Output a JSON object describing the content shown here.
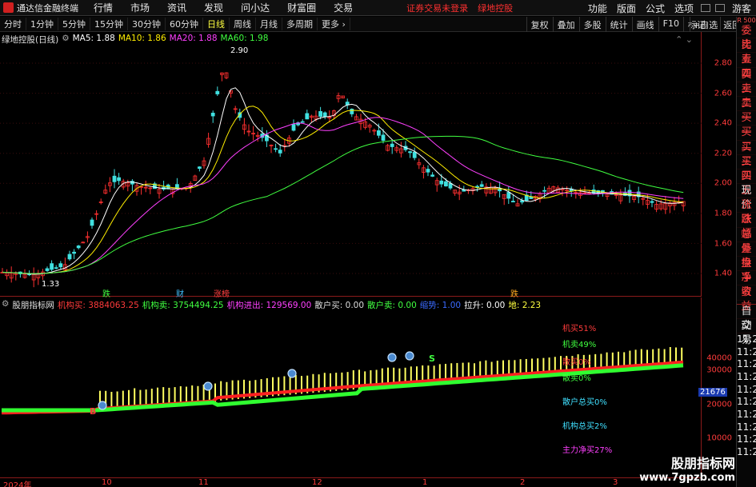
{
  "app_title": "通达信金融终端",
  "menu": [
    "行情",
    "市场",
    "资讯",
    "发现",
    "问小达",
    "财富圈",
    "交易"
  ],
  "notices": [
    "证券交易未登录",
    "绿地控股"
  ],
  "right_menu": [
    "功能",
    "版面",
    "公式",
    "选项",
    "游客"
  ],
  "periods": [
    "分时",
    "1分钟",
    "5分钟",
    "15分钟",
    "30分钟",
    "60分钟",
    "日线",
    "周线",
    "月线",
    "多周期",
    "更多"
  ],
  "active_period": "日线",
  "right_tools": [
    "复权",
    "叠加",
    "多股",
    "统计",
    "画线",
    "F10",
    "标记",
    "+自选",
    "返回"
  ],
  "side": {
    "r500": "R 500",
    "items": [
      "委比",
      "卖五",
      "卖四",
      "卖三",
      "卖二",
      "卖一",
      "买一",
      "买二",
      "买三",
      "买四",
      "买五",
      "现价",
      "涨跌",
      "涨幅",
      "总量",
      "外盘",
      "换手",
      "净资",
      "收益"
    ],
    "lower": [
      "自动",
      "交易"
    ],
    "times": [
      "11:26",
      "11:26",
      "11:26",
      "11:27",
      "11:27",
      "11:27",
      "11:27",
      "11:27",
      "11:27",
      "11:27"
    ]
  },
  "chart_title": "绿地控股(日线)",
  "ma": [
    {
      "label": "MA5: 1.88",
      "color": "#ffffff"
    },
    {
      "label": "MA10: 1.86",
      "color": "#ffee00"
    },
    {
      "label": "MA20: 1.88",
      "color": "#ff40ff"
    },
    {
      "label": "MA60: 1.98",
      "color": "#40ff40"
    }
  ],
  "price_axis": [
    "2.80",
    "2.60",
    "2.40",
    "2.20",
    "2.00",
    "1.80",
    "1.60",
    "1.40"
  ],
  "price_high": "2.90",
  "price_low": "1.33",
  "event_tags": [
    "跌",
    "财",
    "涨榜",
    "跌"
  ],
  "ind": {
    "name": "股朋指标网",
    "fields": [
      {
        "t": "机构买: 3884063.25",
        "c": "#ff3b3b"
      },
      {
        "t": "机构卖: 3754494.25",
        "c": "#40ff40"
      },
      {
        "t": "机构进出: 129569.00",
        "c": "#ff40ff"
      },
      {
        "t": "散户买: 0.00",
        "c": "#dddddd"
      },
      {
        "t": "散户卖: 0.00",
        "c": "#40ff40"
      },
      {
        "t": "缩势: 1.00",
        "c": "#3a6aff"
      },
      {
        "t": "拉升: 0.00",
        "c": "#ffffff"
      },
      {
        "t": "地: 2.23",
        "c": "#ffff40"
      }
    ]
  },
  "ind_axis": [
    "40000",
    "30000",
    "20000",
    "10000"
  ],
  "ind_value": "21676",
  "legend": [
    {
      "t": "机买51%",
      "c": "#ff3b3b"
    },
    {
      "t": "机卖49%",
      "c": "#40ff40"
    },
    {
      "t": "散买0%",
      "c": "#ff3b3b"
    },
    {
      "t": "散卖0%",
      "c": "#40ff40"
    },
    {
      "t": "散户总买0%",
      "c": "#40e0ff"
    },
    {
      "t": "机构总买2%",
      "c": "#40e0ff"
    },
    {
      "t": "主力净买27%",
      "c": "#ff40ff"
    }
  ],
  "marker_b": "B",
  "marker_s": "S",
  "xaxis": [
    "2024年",
    "10",
    "11",
    "12",
    "1",
    "2",
    "3"
  ],
  "watermark": {
    "a": "股朋指标网",
    "b": "www.7gpzb.com"
  }
}
